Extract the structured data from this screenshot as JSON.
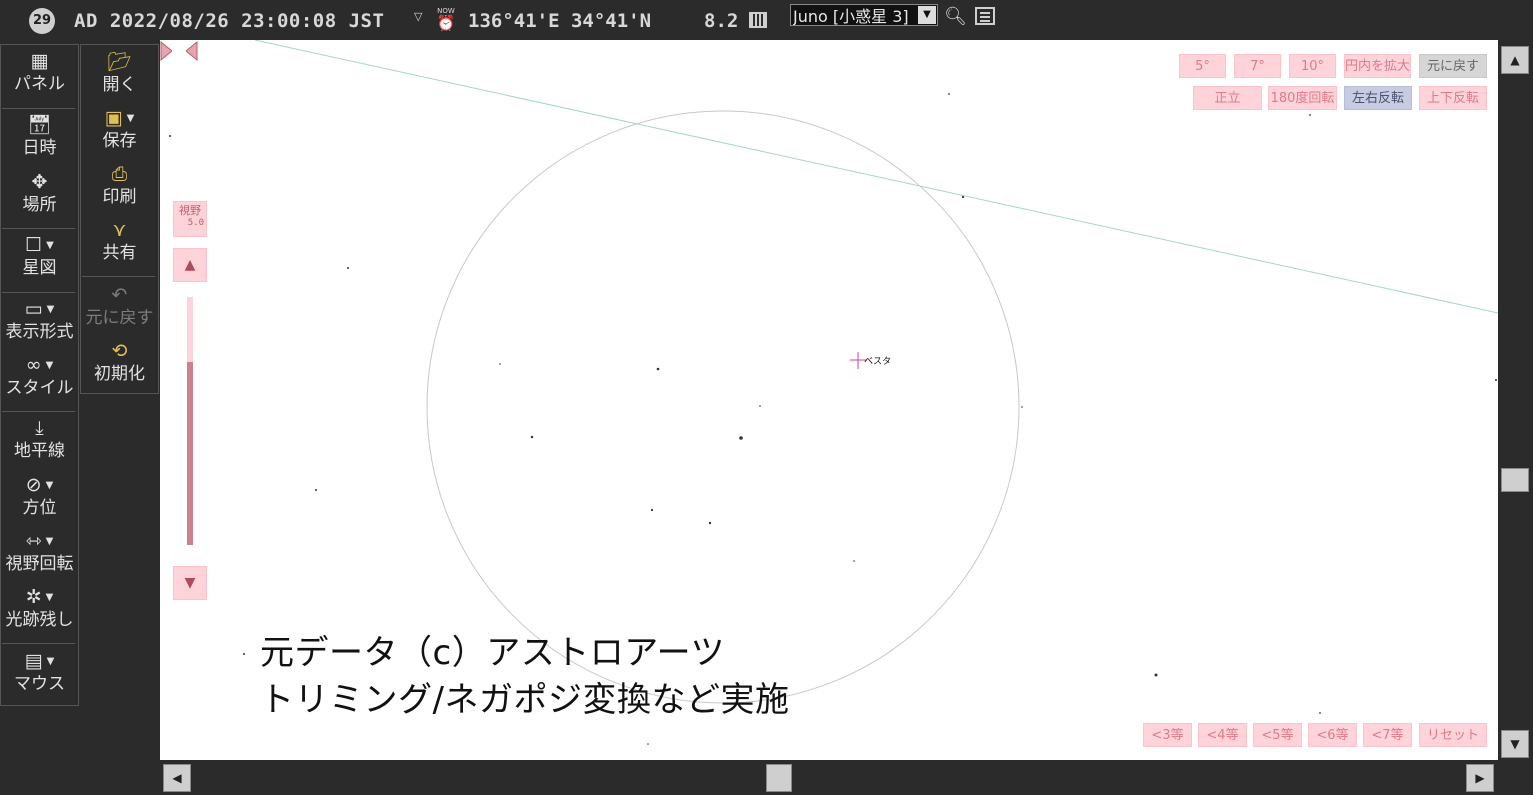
{
  "header": {
    "moon_age": "29",
    "status": "AD 2022/08/26 23:00:08 JST",
    "timezone_arrow": "▽",
    "now_label": "NOW",
    "location": "136°41'E 34°41'N",
    "magnitude": "8.2",
    "object_value": "Juno [小惑星 3]"
  },
  "left_panel": {
    "items": [
      {
        "label": "パネル",
        "icon": "calendar-grid-icon"
      },
      {
        "label": "日時",
        "icon": "clock-calendar-icon"
      },
      {
        "label": "場所",
        "icon": "location-icon"
      },
      {
        "label": "星図",
        "icon": "chart-square-icon"
      },
      {
        "label": "表示形式",
        "icon": "display-format-icon"
      },
      {
        "label": "スタイル",
        "icon": "binoculars-icon"
      },
      {
        "label": "地平線",
        "icon": "horizon-icon"
      },
      {
        "label": "方位",
        "icon": "compass-icon"
      },
      {
        "label": "視野回転",
        "icon": "rotate-view-icon"
      },
      {
        "label": "光跡残し",
        "icon": "trail-icon"
      },
      {
        "label": "マウス",
        "icon": "mouse-icon"
      }
    ]
  },
  "file_panel": {
    "items": [
      {
        "label": "開く",
        "icon": "folder-open-icon"
      },
      {
        "label": "保存",
        "icon": "save-icon"
      },
      {
        "label": "印刷",
        "icon": "print-icon"
      },
      {
        "label": "共有",
        "icon": "share-icon"
      },
      {
        "label": "元に戻す",
        "icon": "undo-icon"
      },
      {
        "label": "初期化",
        "icon": "reset-icon"
      }
    ]
  },
  "map": {
    "fov_buttons": [
      "5°",
      "7°",
      "10°",
      "円内を拡大",
      "元に戻す"
    ],
    "orient_buttons": [
      "正立",
      "180度回転",
      "左右反転",
      "上下反転"
    ],
    "fov_label": "視野",
    "fov_value": "5.0",
    "target_label": "ベスタ",
    "caption_line1": "元データ（c）アストロアーツ",
    "caption_line2": "トリミング/ネガポジ変換など実施",
    "mag_buttons": [
      "<3等",
      "<4等",
      "<5等",
      "<6等",
      "<7等",
      "リセット"
    ]
  }
}
